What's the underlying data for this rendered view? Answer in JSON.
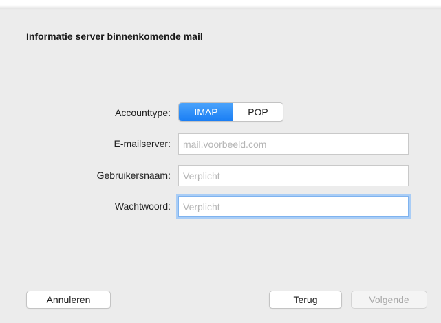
{
  "dialog": {
    "title": "Informatie server binnenkomende mail"
  },
  "form": {
    "account_type": {
      "label": "Accounttype:",
      "options": [
        "IMAP",
        "POP"
      ],
      "selected": "IMAP"
    },
    "email_server": {
      "label": "E-mailserver:",
      "value": "",
      "placeholder": "mail.voorbeeld.com"
    },
    "username": {
      "label": "Gebruikersnaam:",
      "value": "",
      "placeholder": "Verplicht"
    },
    "password": {
      "label": "Wachtwoord:",
      "value": "",
      "placeholder": "Verplicht"
    }
  },
  "buttons": {
    "cancel": "Annuleren",
    "back": "Terug",
    "next": "Volgende"
  },
  "colors": {
    "accent": "#1a7ef4",
    "focus_ring": "#a9cdf6",
    "background": "#ececec"
  }
}
